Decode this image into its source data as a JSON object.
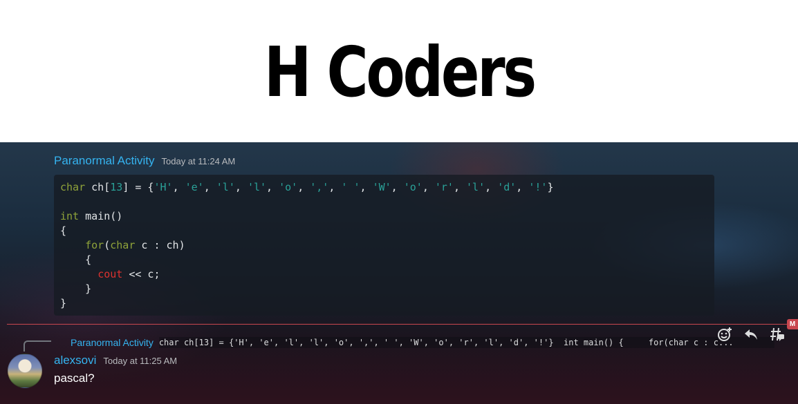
{
  "caption": {
    "text": "H Coders"
  },
  "message1": {
    "username": "Paranormal Activity",
    "timestamp": "Today at 11:24 AM",
    "code": {
      "line1": {
        "t1": "char",
        "t2": " ch[",
        "t3": "13",
        "t4": "] = {",
        "chars": [
          "'H'",
          "'e'",
          "'l'",
          "'l'",
          "'o'",
          "','",
          "' '",
          "'W'",
          "'o'",
          "'r'",
          "'l'",
          "'d'",
          "'!'"
        ],
        "close": "}"
      },
      "line3": {
        "kw": "int",
        "rest": " main()"
      },
      "line4": "{",
      "line5": {
        "indent": "    ",
        "for": "for",
        "open": "(",
        "char": "char",
        "rest": " c : ch)"
      },
      "line6": "    {",
      "line7": {
        "indent": "      ",
        "cout": "cout",
        "rest": " << c;"
      },
      "line8": "    }",
      "line9": "}"
    }
  },
  "reply": {
    "username": "Paranormal Activity",
    "preview": "char ch[13] = {'H', 'e', 'l', 'l', 'o', ',', ' ', 'W', 'o', 'r', 'l', 'd', '!'}  int main() {     for(char c : c..."
  },
  "message2": {
    "username": "alexsovi",
    "timestamp": "Today at 11:25 AM",
    "text": "pascal?"
  },
  "new_badge": "M",
  "toolbar": {
    "icons": [
      "add-reaction-icon",
      "reply-icon",
      "create-thread-icon"
    ]
  },
  "colors": {
    "username": "#35b4f0",
    "divider": "#c9474f",
    "keyword": "#8fa33a",
    "literal": "#2aa198",
    "cout": "#dc322f"
  }
}
